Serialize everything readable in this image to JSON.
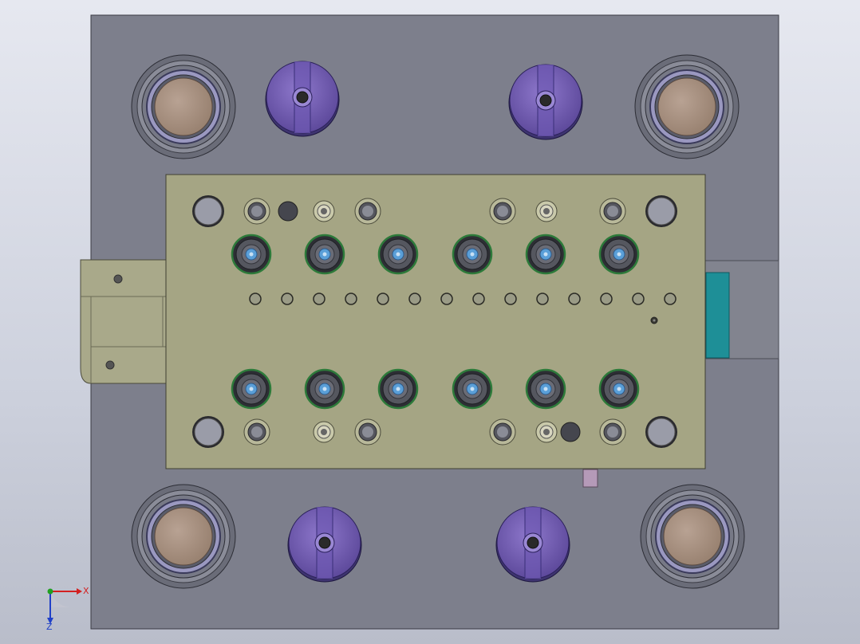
{
  "viewport": {
    "triad": {
      "x_label": "X",
      "z_label": "Z"
    }
  },
  "colors": {
    "background_top": "#e6e8f0",
    "background_bottom": "#b9bdca",
    "base_plate": "#7d7f8c",
    "stripper_plate": "#a5a584",
    "side_block": "#a9a98a",
    "guide_bushing": "#a58f80",
    "nitrogen_spring": "#7b64b4",
    "teal_block": "#1e8f97",
    "punch_ring": "#2d7a3a",
    "punch_tip": "#5a9fd8",
    "axis_x": "#d32020",
    "axis_y": "#20a020",
    "axis_z": "#2040c8"
  }
}
